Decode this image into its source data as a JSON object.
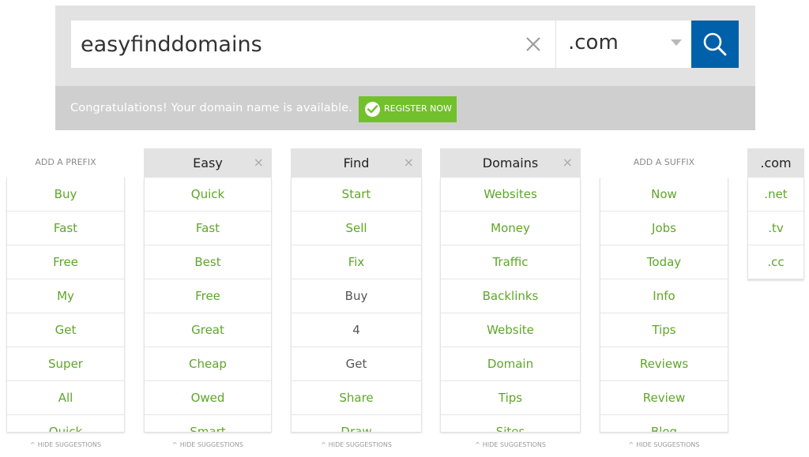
{
  "search": {
    "query": "easyfinddomains",
    "tld": ".com"
  },
  "status": {
    "message": "Congratulations! Your domain name is available.",
    "register_label": "REGISTER NOW"
  },
  "hide_label": "HIDE SUGGESTIONS",
  "columns": [
    {
      "header": "ADD A PREFIX",
      "kind": "plain",
      "items": [
        "Buy",
        "Fast",
        "Free",
        "My",
        "Get",
        "Super",
        "All",
        "Quick"
      ]
    },
    {
      "header": "Easy",
      "kind": "word",
      "items": [
        "Quick",
        "Fast",
        "Best",
        "Free",
        "Great",
        "Cheap",
        "Owed",
        "Smart"
      ]
    },
    {
      "header": "Find",
      "kind": "word",
      "items": [
        "Start",
        "Sell",
        "Fix",
        "Buy",
        "4",
        "Get",
        "Share",
        "Draw"
      ]
    },
    {
      "header": "Domains",
      "kind": "word",
      "items": [
        "Websites",
        "Money",
        "Traffic",
        "Backlinks",
        "Website",
        "Domain",
        "Tips",
        "Sites"
      ]
    },
    {
      "header": "ADD A SUFFIX",
      "kind": "plain",
      "items": [
        "Now",
        "Jobs",
        "Today",
        "Info",
        "Tips",
        "Reviews",
        "Review",
        "Blog"
      ]
    }
  ],
  "tld_column": {
    "header": ".com",
    "items": [
      ".net",
      ".tv",
      ".cc"
    ]
  },
  "colors": {
    "accent_blue": "#0060a9",
    "accent_green": "#72c02c",
    "suggestion_text": "#5fa52a"
  }
}
